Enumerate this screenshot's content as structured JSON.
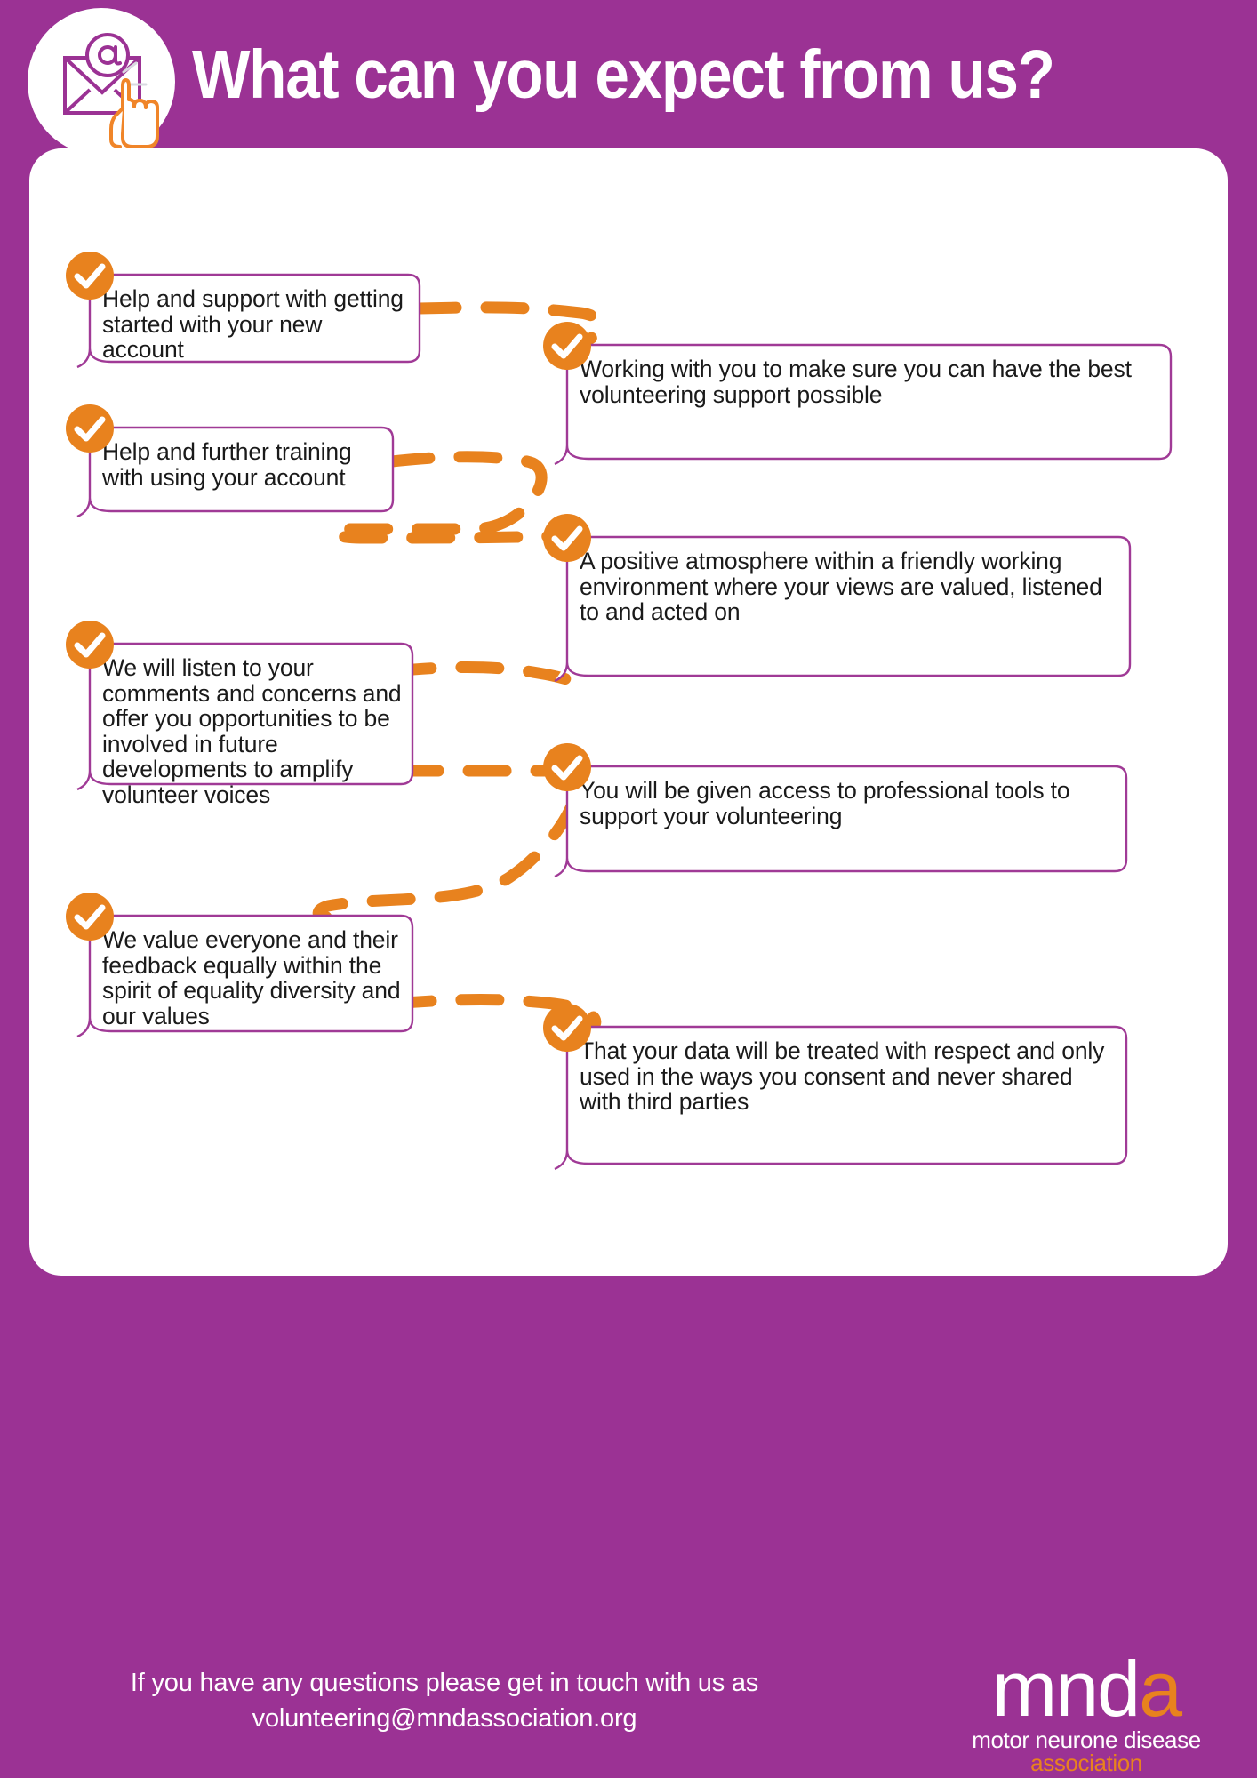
{
  "page": {
    "title": "What can you expect from us?",
    "background_color": "#9B3294",
    "card_color": "#FFFFFF",
    "accent_orange": "#E8821E",
    "border_purple": "#A03A96",
    "text_color": "#1A1A1A"
  },
  "header": {
    "title": "What can you expect from us?",
    "icon_name": "email-envelope-click-icon"
  },
  "items": [
    {
      "id": 1,
      "side": "left",
      "text": "Help and support with getting started with your new account",
      "icon": "check-circle-icon"
    },
    {
      "id": 2,
      "side": "right",
      "text": "Working with you to make sure you can have the best volunteering support possible",
      "icon": "check-circle-icon"
    },
    {
      "id": 3,
      "side": "left",
      "text": "Help and further training with using your account",
      "icon": "check-circle-icon"
    },
    {
      "id": 4,
      "side": "right",
      "text": "A positive atmosphere within a friendly working environment where your views are valued, listened to and acted on",
      "icon": "check-circle-icon"
    },
    {
      "id": 5,
      "side": "left",
      "text": "We will listen to your comments and concerns and offer you opportunities to be involved in future developments to amplify volunteer voices",
      "icon": "check-circle-icon"
    },
    {
      "id": 6,
      "side": "right",
      "text": "You will be given access to professional tools to support your volunteering",
      "icon": "check-circle-icon"
    },
    {
      "id": 7,
      "side": "left",
      "text": "We value everyone and their feedback equally within the spirit of equality diversity and our values",
      "icon": "check-circle-icon"
    },
    {
      "id": 8,
      "side": "right",
      "text": "That your data will be treated with respect and only used in the ways you consent and never shared with third parties",
      "icon": "check-circle-icon"
    }
  ],
  "footer": {
    "line_1": "If you have any questions please get in touch with us as",
    "line_2": "volunteering@mndassociation.org",
    "logo": {
      "word_main": "mnd",
      "word_accent": "a",
      "sub_line_1": "motor neurone disease",
      "sub_line_2": "association"
    }
  }
}
